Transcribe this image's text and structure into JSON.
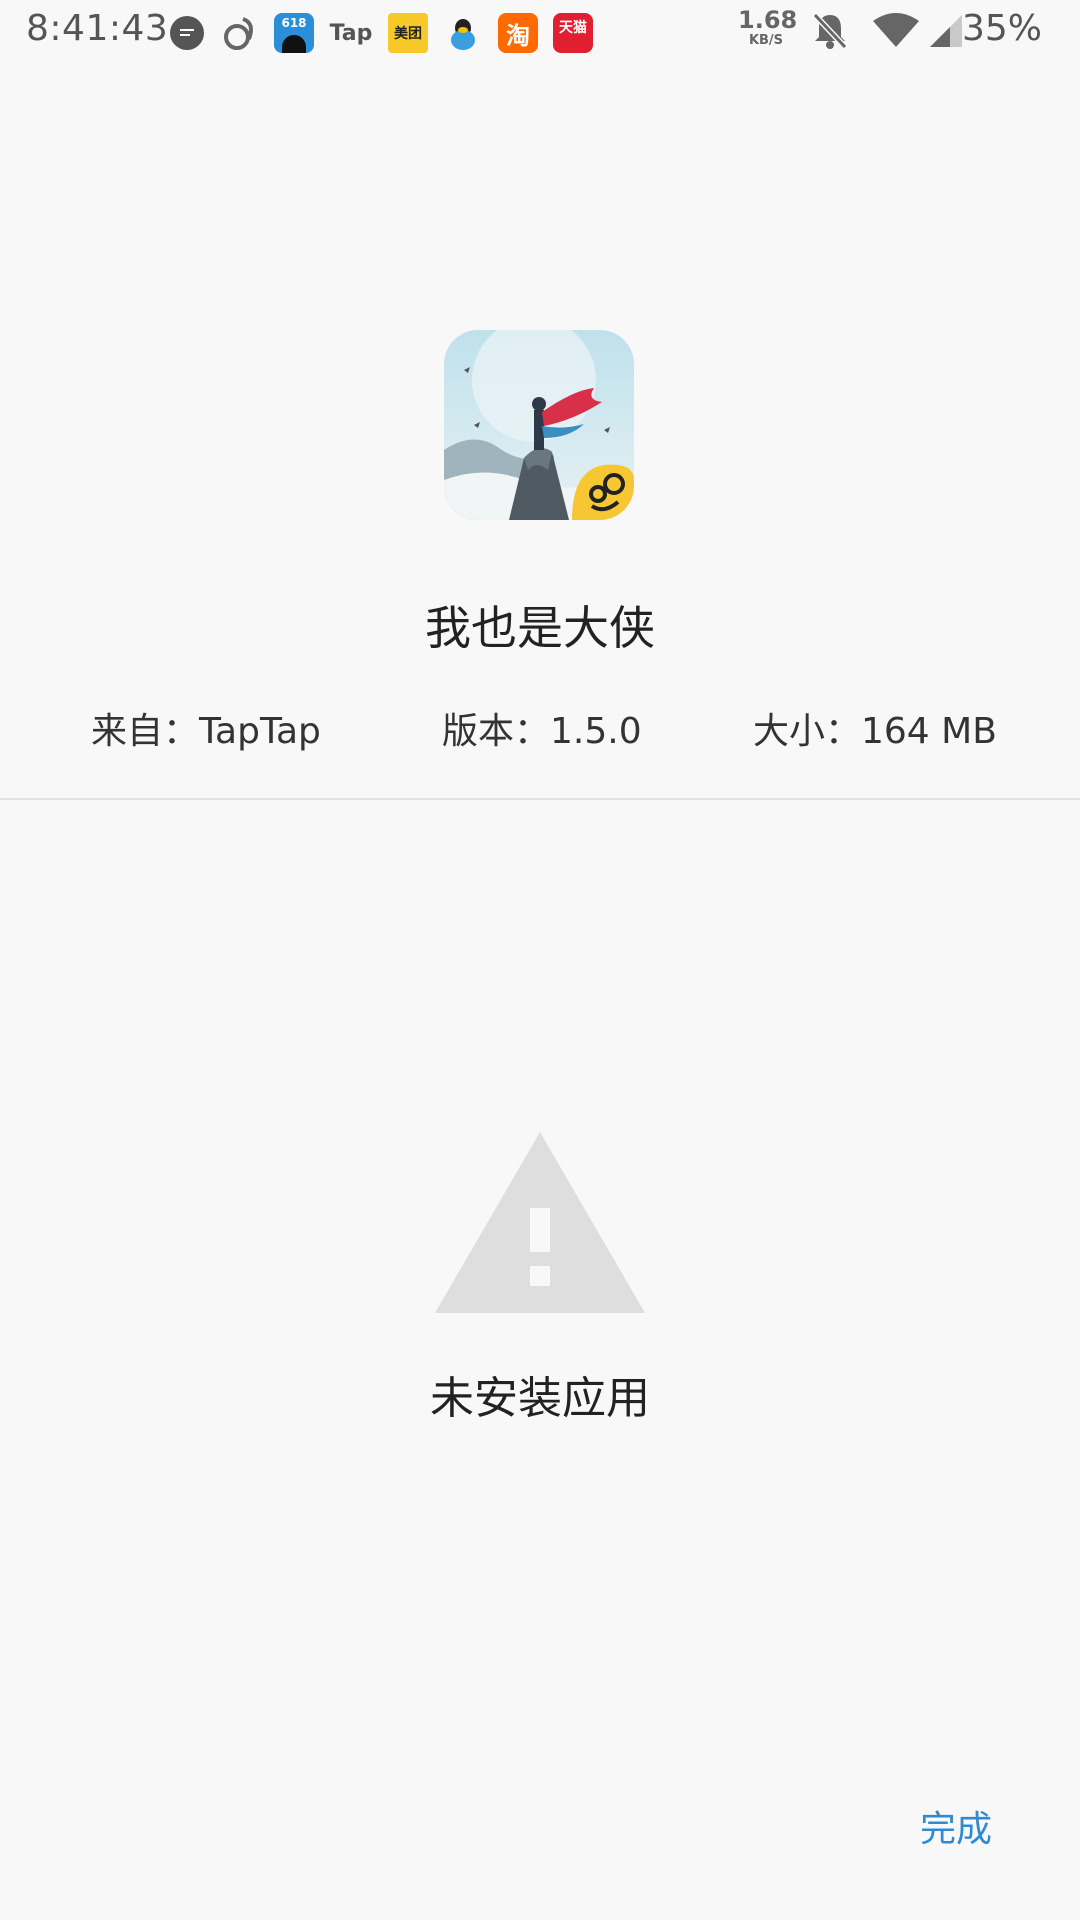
{
  "status_bar": {
    "time": "8:41:43",
    "notification_icons": [
      "chat-bubble-icon",
      "squirrel-browser-icon",
      "618-app-icon",
      "tap-app-icon",
      "meituan-app-icon",
      "qq-penguin-icon",
      "taobao-app-icon",
      "tmall-app-icon"
    ],
    "tap_label": "Tap",
    "meituan_label": "美团",
    "taobao_label": "淘",
    "tmall_label": "天猫",
    "app618_label": "618",
    "net_speed_value": "1.68",
    "net_speed_unit": "KB/S",
    "battery": "35%"
  },
  "app": {
    "name": "我也是大侠",
    "source": "来自：TapTap",
    "version": "版本：1.5.0",
    "size": "大小：164 MB"
  },
  "result": {
    "message": "未安装应用"
  },
  "actions": {
    "done_label": "完成"
  },
  "colors": {
    "accent": "#2f8bd1",
    "background": "#f8f8f8",
    "warning_icon": "#dedede"
  }
}
